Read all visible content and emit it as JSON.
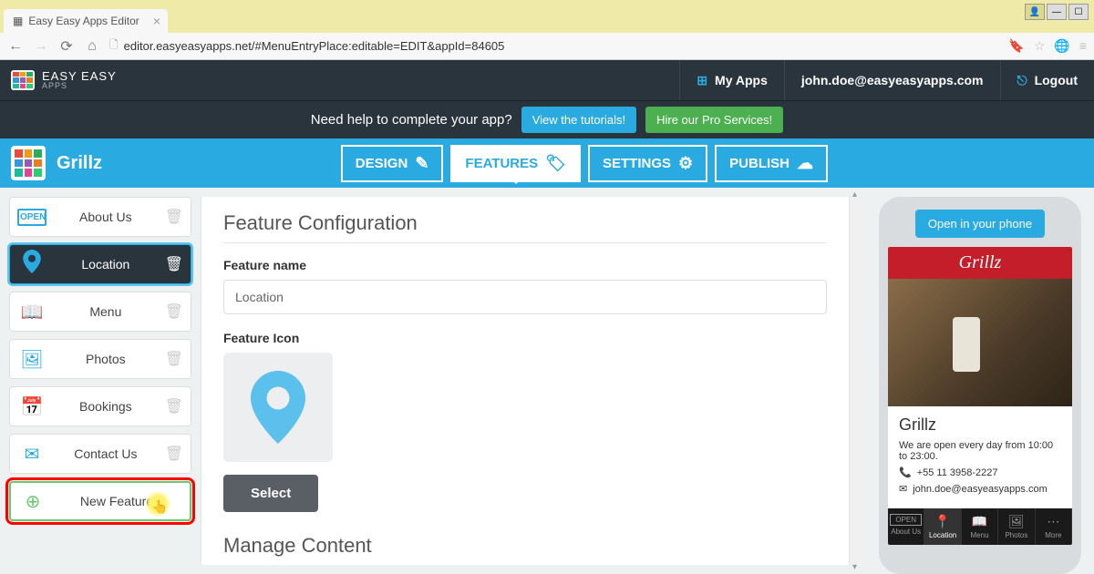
{
  "browser": {
    "tab_title": "Easy Easy Apps Editor",
    "url": "editor.easyeasyapps.net/#MenuEntryPlace:editable=EDIT&appId=84605"
  },
  "appbar": {
    "brand_line1": "EASY EASY",
    "brand_line2": "APPS",
    "my_apps": "My Apps",
    "user_email": "john.doe@easyeasyapps.com",
    "logout": "Logout"
  },
  "helpbar": {
    "prompt": "Need help to complete your app?",
    "tutorials": "View the tutorials!",
    "pro": "Hire our Pro Services!"
  },
  "bluenav": {
    "app_name": "Grillz",
    "tabs": {
      "design": "DESIGN",
      "features": "FEATURES",
      "settings": "SETTINGS",
      "publish": "PUBLISH"
    }
  },
  "sidebar": {
    "items": [
      {
        "label": "About Us"
      },
      {
        "label": "Location"
      },
      {
        "label": "Menu"
      },
      {
        "label": "Photos"
      },
      {
        "label": "Bookings"
      },
      {
        "label": "Contact Us"
      }
    ],
    "new_feature": "New Feature"
  },
  "content": {
    "heading": "Feature Configuration",
    "name_label": "Feature name",
    "name_value": "Location",
    "icon_label": "Feature Icon",
    "select_btn": "Select",
    "manage": "Manage Content"
  },
  "preview": {
    "open_btn": "Open in your phone",
    "header": "Grillz",
    "title": "Grillz",
    "hours": "We are open every day from 10:00 to 23:00.",
    "phone": "+55 11 3958-2227",
    "email": "john.doe@easyeasyapps.com",
    "tabs": [
      "About Us",
      "Location",
      "Menu",
      "Photos",
      "More"
    ]
  }
}
